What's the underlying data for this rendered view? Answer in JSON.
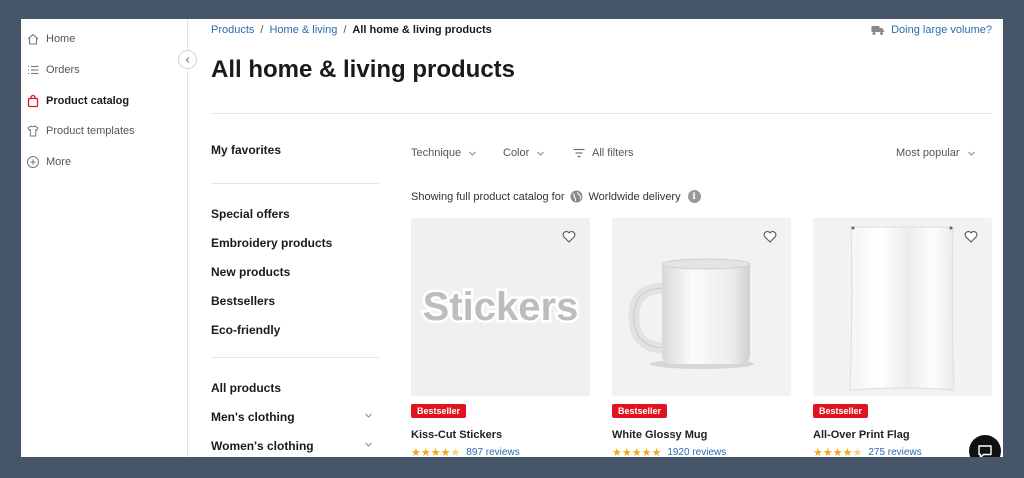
{
  "nav": {
    "items": [
      {
        "label": "Home",
        "icon": "home-icon",
        "active": false
      },
      {
        "label": "Orders",
        "icon": "list-icon",
        "active": false
      },
      {
        "label": "Product catalog",
        "icon": "shopping-bag-icon",
        "active": true
      },
      {
        "label": "Product templates",
        "icon": "tshirt-icon",
        "active": false
      },
      {
        "label": "More",
        "icon": "plus-circle-icon",
        "active": false
      }
    ]
  },
  "breadcrumb": {
    "items": [
      "Products",
      "Home & living"
    ],
    "current": "All home & living products"
  },
  "volume_link": "Doing large volume?",
  "page_title": "All home & living products",
  "categories": {
    "favorites": "My favorites",
    "group1": [
      "Special offers",
      "Embroidery products",
      "New products",
      "Bestsellers",
      "Eco-friendly"
    ],
    "group2": [
      "All products",
      "Men's clothing",
      "Women's clothing"
    ]
  },
  "filters": {
    "technique": "Technique",
    "color": "Color",
    "all_filters": "All filters",
    "sort": "Most popular"
  },
  "catalog_note": {
    "prefix": "Showing full product catalog for",
    "region": "Worldwide delivery",
    "info_glyph": "i"
  },
  "products": [
    {
      "badge": "Bestseller",
      "name": "Kiss-Cut Stickers",
      "reviews": "897 reviews",
      "image_text": "Stickers",
      "rating": 4.5
    },
    {
      "badge": "Bestseller",
      "name": "White Glossy Mug",
      "reviews": "1920 reviews",
      "rating": 5
    },
    {
      "badge": "Bestseller",
      "name": "All-Over Print Flag",
      "reviews": "275 reviews",
      "rating": 4.5
    }
  ],
  "colors": {
    "accent_link": "#2b6cb0",
    "badge_red": "#e0141e",
    "star": "#f2a816",
    "active_icon": "#e0141e",
    "frame": "#475569"
  }
}
